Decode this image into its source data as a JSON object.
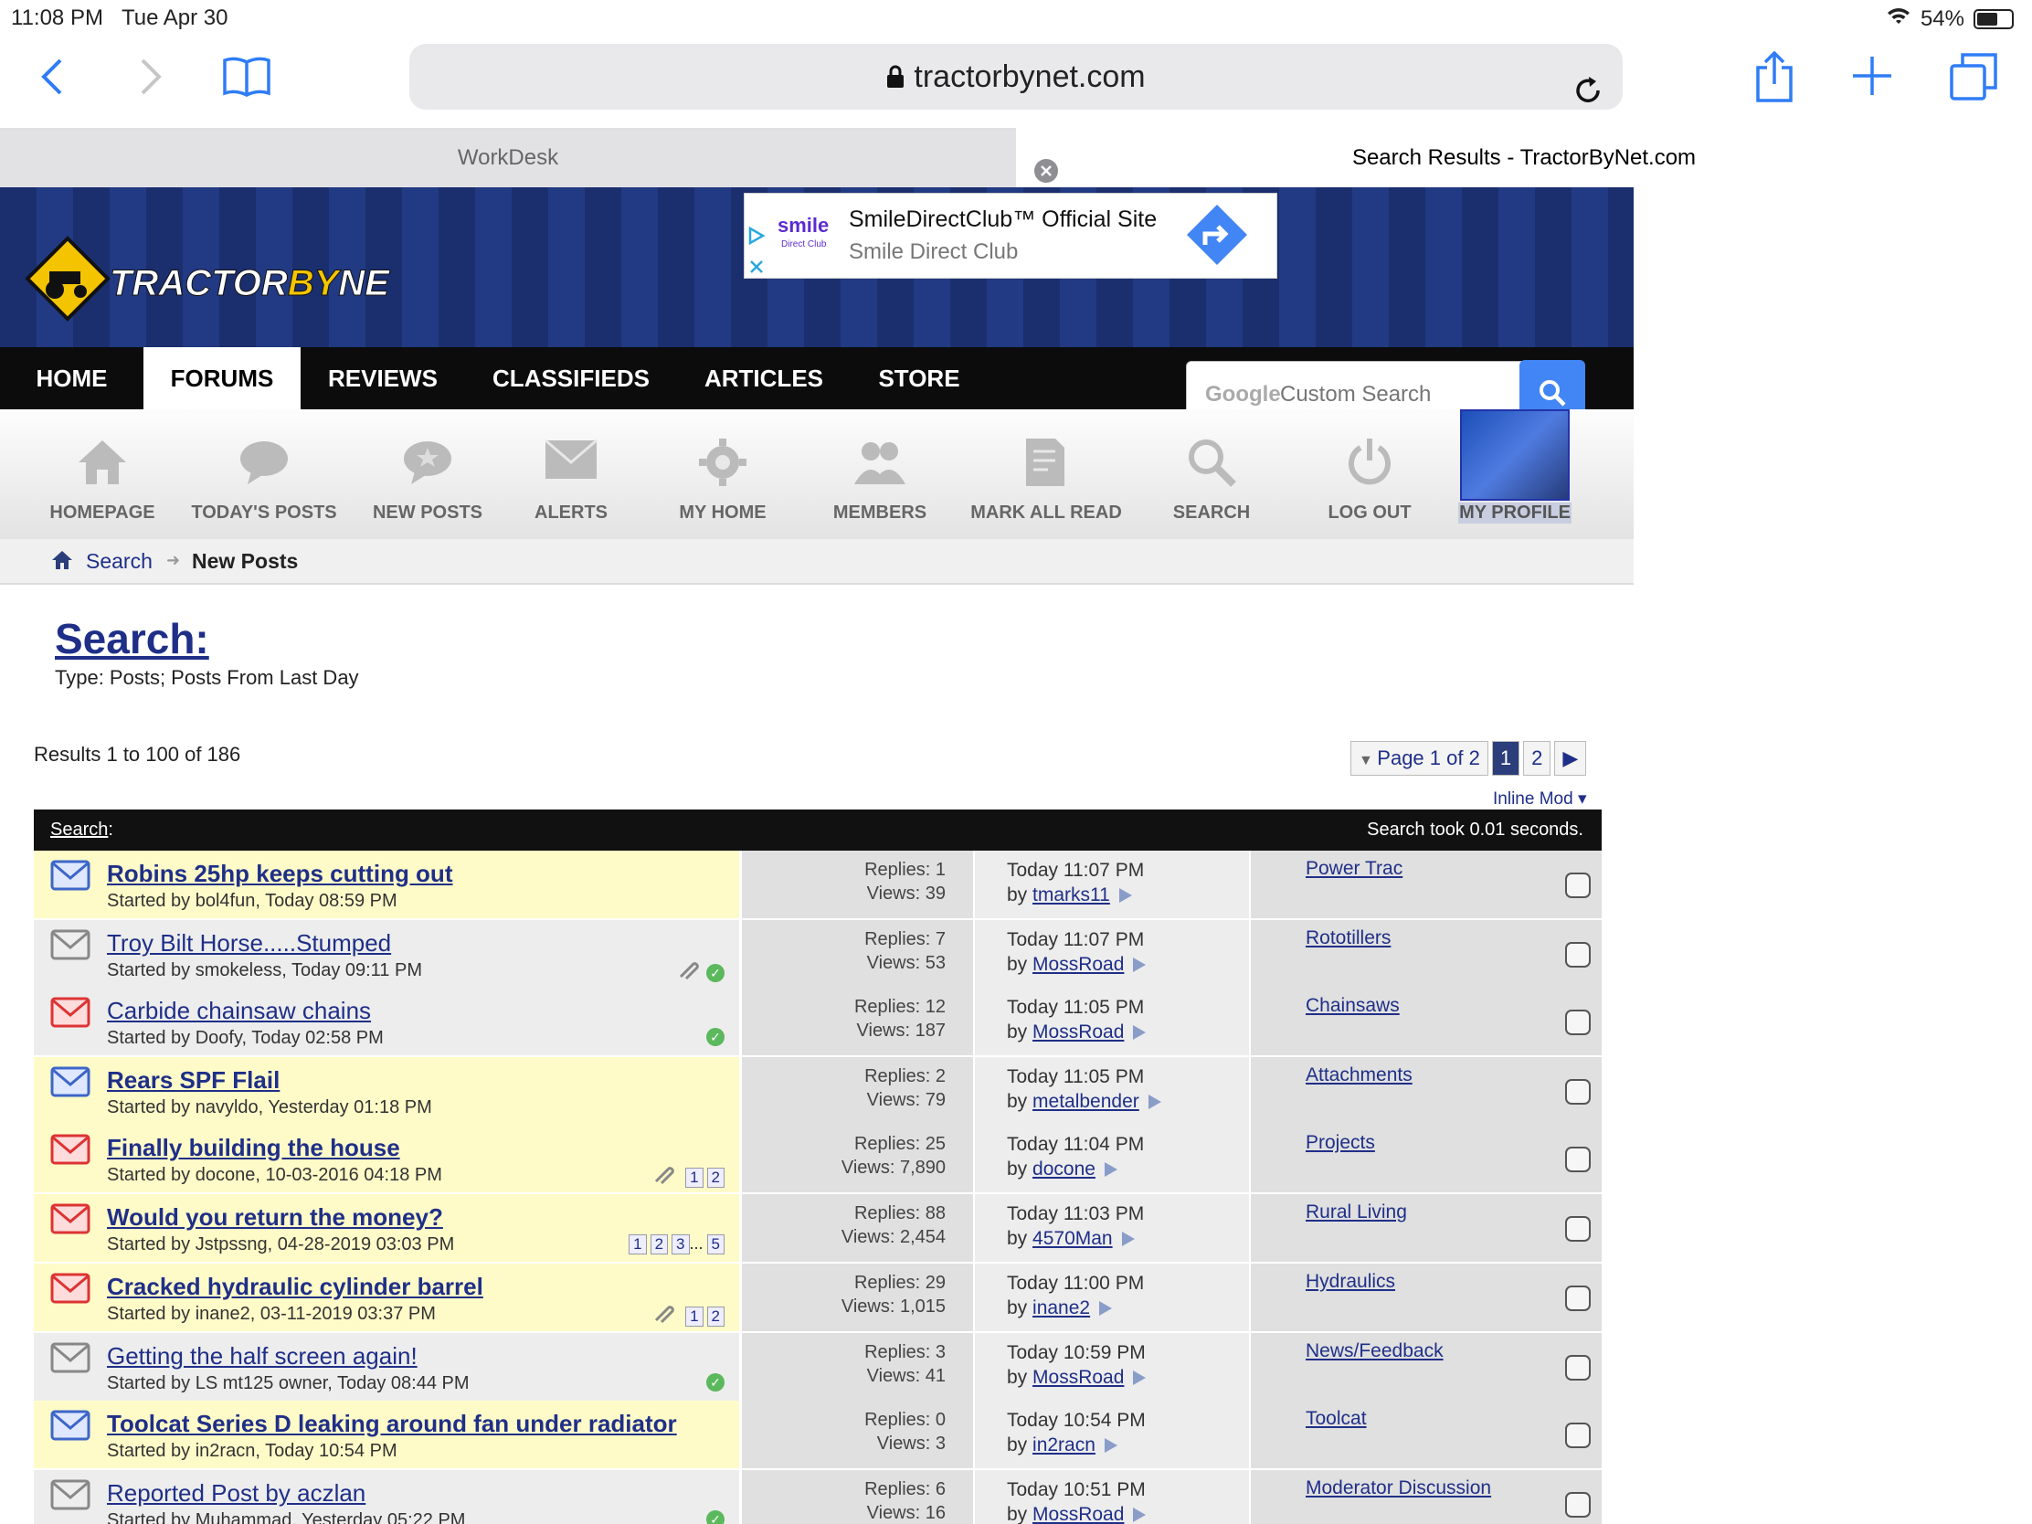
{
  "status_bar": {
    "time": "11:08 PM",
    "date": "Tue Apr 30",
    "battery": "54%"
  },
  "browser": {
    "url": "tractorbynet.com"
  },
  "tabs": [
    {
      "label": "WorkDesk"
    },
    {
      "label": "Search Results - TractorByNet.com"
    }
  ],
  "ad": {
    "brand": "smile",
    "brand_sub": "Direct Club",
    "title": "SmileDirectClub™ Official Site",
    "subtitle": "Smile Direct Club"
  },
  "logo_text": "TRACTORBYNET",
  "nav": [
    {
      "label": "HOME"
    },
    {
      "label": "FORUMS"
    },
    {
      "label": "REVIEWS"
    },
    {
      "label": "CLASSIFIEDS"
    },
    {
      "label": "ARTICLES"
    },
    {
      "label": "STORE"
    }
  ],
  "search_box": {
    "google": "Google",
    "placeholder": "Custom Search"
  },
  "subnav": [
    {
      "label": "HOMEPAGE"
    },
    {
      "label": "TODAY'S POSTS"
    },
    {
      "label": "NEW POSTS"
    },
    {
      "label": "ALERTS"
    },
    {
      "label": "MY HOME"
    },
    {
      "label": "MEMBERS"
    },
    {
      "label": "MARK ALL READ"
    },
    {
      "label": "SEARCH"
    },
    {
      "label": "LOG OUT"
    },
    {
      "label": "MY PROFILE"
    }
  ],
  "breadcrumb": {
    "link": "Search",
    "current": "New Posts"
  },
  "page": {
    "title": "Search:",
    "subtitle": "Type: Posts; Posts From Last Day",
    "results": "Results 1 to 100 of 186",
    "inline_mod": "Inline Mod"
  },
  "pager": {
    "label": "Page 1 of 2",
    "pages": [
      "1",
      "2"
    ]
  },
  "table_header": {
    "left": "Search",
    "colon": ":",
    "right": "Search took 0.01 seconds."
  },
  "threads": [
    {
      "title": "Robins 25hp keeps cutting out",
      "starter": "Started by bol4fun, Today 08:59 PM",
      "replies": "Replies: 1",
      "views": "Views: 39",
      "last": "Today 11:07 PM",
      "by": "by",
      "user": "tmarks11",
      "forum": "Power Trac"
    },
    {
      "title": "Troy Bilt Horse.....Stumped",
      "starter": "Started by smokeless, Today 09:11 PM",
      "replies": "Replies: 7",
      "views": "Views: 53",
      "last": "Today 11:07 PM",
      "by": "by",
      "user": "MossRoad",
      "forum": "Rototillers"
    },
    {
      "title": "Carbide chainsaw chains",
      "starter": "Started by Doofy, Today 02:58 PM",
      "replies": "Replies: 12",
      "views": "Views: 187",
      "last": "Today 11:05 PM",
      "by": "by",
      "user": "MossRoad",
      "forum": "Chainsaws"
    },
    {
      "title": "Rears SPF Flail",
      "starter": "Started by navyldo, Yesterday 01:18 PM",
      "replies": "Replies: 2",
      "views": "Views: 79",
      "last": "Today 11:05 PM",
      "by": "by",
      "user": "metalbender",
      "forum": "Attachments"
    },
    {
      "title": "Finally building the house",
      "starter": "Started by docone, 10-03-2016 04:18 PM",
      "replies": "Replies: 25",
      "views": "Views: 7,890",
      "last": "Today 11:04 PM",
      "by": "by",
      "user": "docone",
      "forum": "Projects",
      "pages": [
        "1",
        "2"
      ]
    },
    {
      "title": "Would you return the money?",
      "starter": "Started by Jstpssng, 04-28-2019 03:03 PM",
      "replies": "Replies: 88",
      "views": "Views: 2,454",
      "last": "Today 11:03 PM",
      "by": "by",
      "user": "4570Man",
      "forum": "Rural Living",
      "pages": [
        "1",
        "2",
        "3",
        "...",
        "5"
      ]
    },
    {
      "title": "Cracked hydraulic cylinder barrel",
      "starter": "Started by inane2, 03-11-2019 03:37 PM",
      "replies": "Replies: 29",
      "views": "Views: 1,015",
      "last": "Today 11:00 PM",
      "by": "by",
      "user": "inane2",
      "forum": "Hydraulics",
      "pages": [
        "1",
        "2"
      ]
    },
    {
      "title": "Getting the half screen again!",
      "starter": "Started by LS mt125 owner, Today 08:44 PM",
      "replies": "Replies: 3",
      "views": "Views: 41",
      "last": "Today 10:59 PM",
      "by": "by",
      "user": "MossRoad",
      "forum": "News/Feedback"
    },
    {
      "title": "Toolcat Series D leaking around fan under radiator",
      "starter": "Started by in2racn, Today 10:54 PM",
      "replies": "Replies: 0",
      "views": "Views: 3",
      "last": "Today 10:54 PM",
      "by": "by",
      "user": "in2racn",
      "forum": "Toolcat"
    },
    {
      "title": "Reported Post by aczlan",
      "starter": "Started by Muhammad, Yesterday 05:22 PM",
      "replies": "Replies: 6",
      "views": "Views: 16",
      "last": "Today 10:51 PM",
      "by": "by",
      "user": "MossRoad",
      "forum": "Moderator Discussion"
    }
  ]
}
